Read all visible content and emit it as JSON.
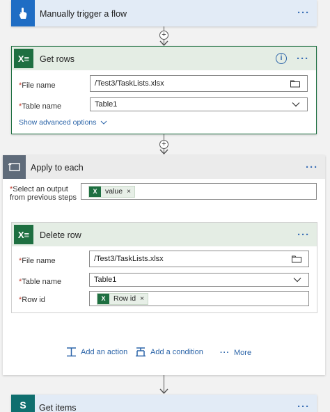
{
  "trigger": {
    "title": "Manually trigger a flow",
    "icon": "hand-touch-icon"
  },
  "get_rows": {
    "title": "Get rows",
    "icon": "excel-icon",
    "info_icon": "info-icon",
    "fields": {
      "file_name": {
        "label": "File name",
        "value": "/Test3/TaskLists.xlsx"
      },
      "table_name": {
        "label": "Table name",
        "value": "Table1"
      }
    },
    "advanced": "Show advanced options"
  },
  "apply_each": {
    "title": "Apply to each",
    "icon": "loop-icon",
    "select_label_line1": "Select an output",
    "select_label_line2": "from previous steps",
    "token": "value"
  },
  "delete_row": {
    "title": "Delete row",
    "icon": "excel-icon",
    "fields": {
      "file_name": {
        "label": "File name",
        "value": "/Test3/TaskLists.xlsx"
      },
      "table_name": {
        "label": "Table name",
        "value": "Table1"
      },
      "row_id": {
        "label": "Row id",
        "token": "Row id"
      }
    }
  },
  "actions": {
    "add_action": "Add an action",
    "add_condition": "Add a condition",
    "more": "More"
  },
  "get_items": {
    "title": "Get items",
    "icon": "sharepoint-icon"
  },
  "colors": {
    "accent": "#2b64a8",
    "excel_green": "#1e6f41",
    "excel_header": "#e4ede4",
    "trigger_header": "#e2ebf6",
    "apply_header": "#ebebeb",
    "trigger_icon_bg": "#1f6dc4",
    "required": "#c0392b"
  }
}
